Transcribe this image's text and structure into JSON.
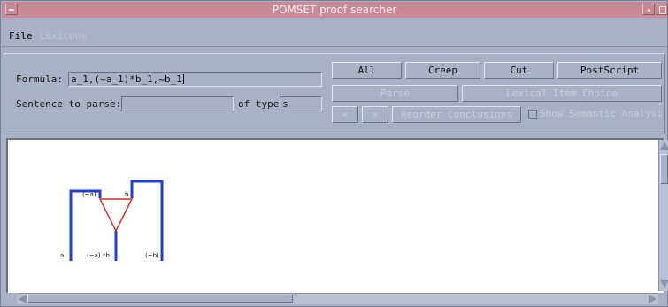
{
  "window": {
    "title": "POMSET proof searcher"
  },
  "menu": {
    "file": "File",
    "lexicons": "Lexicons"
  },
  "form": {
    "formula_label": "Formula:",
    "formula_value": "a_1,(~a_1)*b_1,~b_1",
    "sentence_label": "Sentence to parse:",
    "sentence_value": "",
    "type_label": "of type:",
    "type_value": "s"
  },
  "buttons": {
    "all": "All",
    "creep": "Creep",
    "cut": "Cut",
    "postscript": "PostScript",
    "parse": "Parse",
    "lexical_item_choice": "Lexical Item Choice",
    "prev": "<",
    "next": ">",
    "reorder_conclusions": "Reorder Conclusions",
    "semantic_analysis": "Show Semantic Analysis"
  },
  "button_states": {
    "all": "enabled",
    "creep": "enabled",
    "cut": "enabled",
    "postscript": "enabled",
    "parse": "disabled",
    "lexical_item_choice": "disabled",
    "prev": "disabled",
    "next": "disabled",
    "reorder_conclusions": "disabled",
    "semantic_analysis": "disabled"
  },
  "proof": {
    "labels": {
      "neg_a": "(~a)",
      "b": "b",
      "a": "a",
      "neg_a_times_b": "(~a) *b",
      "neg_b": "(~b)"
    },
    "colors": {
      "axiom": "#1f3fd1",
      "tensor": "#e02b2b"
    }
  }
}
